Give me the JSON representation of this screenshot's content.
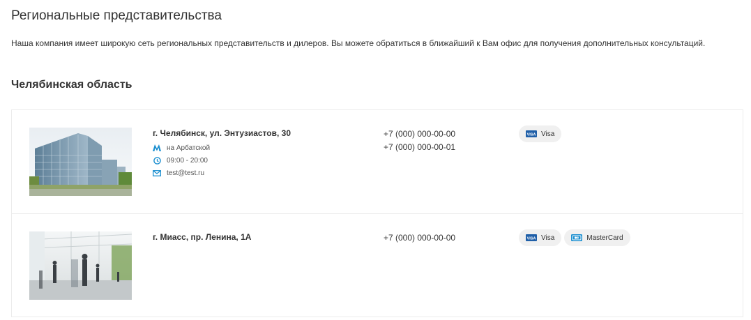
{
  "page": {
    "title": "Региональные представительства",
    "intro": "Наша компания имеет широкую сеть региональных представительств и дилеров. Вы можете обратиться в ближайший к Вам офис для получения дополнительных консультаций.",
    "region": "Челябинская область"
  },
  "offices": [
    {
      "address": "г. Челябинск, ул. Энтузиастов, 30",
      "metro": "на Арбатской",
      "hours": "09:00 - 20:00",
      "email": "test@test.ru",
      "phones": [
        "+7 (000) 000-00-00",
        "+7 (000) 000-00-01"
      ],
      "payments": [
        {
          "label": "Visa",
          "icon": "visa-icon"
        }
      ]
    },
    {
      "address": "г. Миасс, пр. Ленина, 1А",
      "phones": [
        "+7 (000) 000-00-00"
      ],
      "payments": [
        {
          "label": "Visa",
          "icon": "visa-icon"
        },
        {
          "label": "MasterCard",
          "icon": "mastercard-icon"
        }
      ]
    }
  ],
  "colors": {
    "accent": "#1b8fd0",
    "chip_bg": "#f0f0f0",
    "border": "#ececec"
  }
}
